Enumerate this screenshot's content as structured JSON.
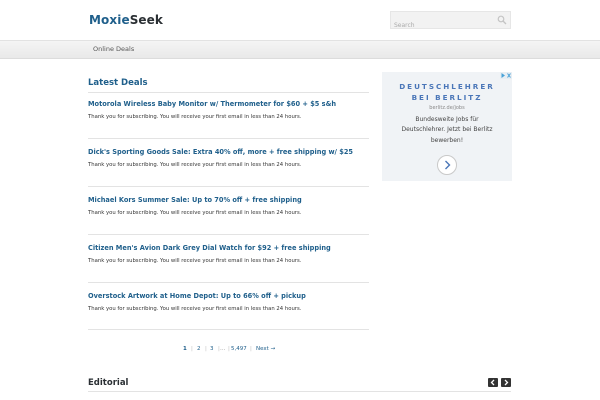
{
  "header": {
    "logo_part1": "Moxie",
    "logo_part2": "Seek",
    "search_placeholder": "Search"
  },
  "nav": {
    "items": [
      {
        "label": "Online Deals"
      }
    ]
  },
  "latest": {
    "title": "Latest Deals",
    "deals": [
      {
        "title": "Motorola Wireless Baby Monitor w/ Thermometer for $60 + $5 s&h",
        "text": "Thank you for subscribing. You will receive your first email in less than 24 hours."
      },
      {
        "title": "Dick's Sporting Goods Sale: Extra 40% off, more + free shipping w/ $25",
        "text": "Thank you for subscribing. You will receive your first email in less than 24 hours."
      },
      {
        "title": "Michael Kors Summer Sale: Up to 70% off + free shipping",
        "text": "Thank you for subscribing. You will receive your first email in less than 24 hours."
      },
      {
        "title": "Citizen Men's Avion Dark Grey Dial Watch for $92 + free shipping",
        "text": "Thank you for subscribing. You will receive your first email in less than 24 hours."
      },
      {
        "title": "Overstock Artwork at Home Depot: Up to 66% off + pickup",
        "text": "Thank you for subscribing. You will receive your first email in less than 24 hours."
      }
    ]
  },
  "pagination": {
    "pages": [
      "1",
      "2",
      "3"
    ],
    "ellipsis": "…",
    "last": "5,497",
    "next": "Next →"
  },
  "ad": {
    "headline1": "DEUTSCHLEHRER",
    "headline2": "BEI BERLITZ",
    "url": "berlitz.de/jobs",
    "body1": "Bundesweite Jobs für",
    "body2": "Deutschlehrer. Jetzt bei Berlitz",
    "body3": "bewerben!"
  },
  "editorial": {
    "title": "Editorial"
  },
  "colors": {
    "link": "#1f5f8b",
    "nav_bg": "#eeeeee",
    "ad_bg": "#f0f3f6",
    "ad_headline": "#4a76b8"
  },
  "icons": {
    "search": "magnifier-icon",
    "ad_choices": "ad-choices-icon",
    "ad_arrow": "chevron-right-icon",
    "prev": "chevron-left-icon",
    "next": "chevron-right-icon"
  }
}
